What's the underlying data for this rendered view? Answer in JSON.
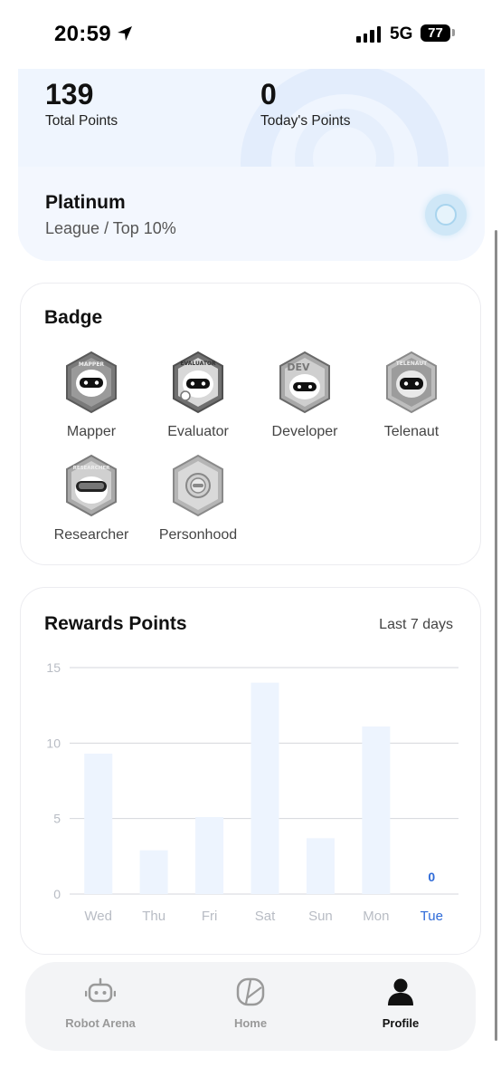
{
  "status_bar": {
    "time": "20:59",
    "network": "5G",
    "battery": "77"
  },
  "stats": {
    "total_points_value": "139",
    "total_points_label": "Total Points",
    "today_points_value": "0",
    "today_points_label": "Today's Points"
  },
  "league": {
    "name": "Platinum",
    "subtitle": "League / Top 10%"
  },
  "badges": {
    "title": "Badge",
    "items": [
      {
        "label": "Mapper",
        "icon": "mapper-robot-badge-icon"
      },
      {
        "label": "Evaluator",
        "icon": "evaluator-robot-badge-icon"
      },
      {
        "label": "Developer",
        "icon": "developer-robot-badge-icon"
      },
      {
        "label": "Telenaut",
        "icon": "telenaut-robot-badge-icon"
      },
      {
        "label": "Researcher",
        "icon": "researcher-robot-badge-icon"
      },
      {
        "label": "Personhood",
        "icon": "personhood-badge-icon"
      }
    ]
  },
  "rewards": {
    "title": "Rewards Points",
    "range": "Last 7 days"
  },
  "chart_data": {
    "type": "bar",
    "categories": [
      "Wed",
      "Thu",
      "Fri",
      "Sat",
      "Sun",
      "Mon",
      "Tue"
    ],
    "values": [
      9.3,
      2.9,
      5.1,
      14,
      3.7,
      11.1,
      0
    ],
    "data_labels": {
      "Tue": "0"
    },
    "yticks": [
      "0",
      "5",
      "10",
      "15"
    ],
    "ylim": [
      0,
      15
    ],
    "grid": true,
    "highlight_category": "Tue",
    "colors": {
      "bar": "#edf4fe",
      "highlight": "#2f6bd8",
      "axis_text": "#b8bcc4"
    }
  },
  "nav": {
    "items": [
      {
        "label": "Robot Arena",
        "icon": "robot-icon"
      },
      {
        "label": "Home",
        "icon": "home-clock-icon"
      },
      {
        "label": "Profile",
        "icon": "person-icon",
        "active": true
      }
    ]
  }
}
